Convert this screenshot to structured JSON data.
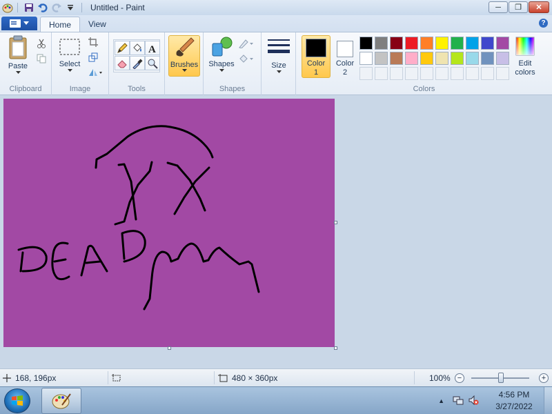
{
  "window": {
    "title": "Untitled - Paint",
    "min_symbol": "─",
    "max_symbol": "❐",
    "close_symbol": "✕"
  },
  "ribbon": {
    "tabs": [
      {
        "label": "Home",
        "active": true
      },
      {
        "label": "View",
        "active": false
      }
    ],
    "help_symbol": "?",
    "groups": {
      "clipboard": {
        "label": "Clipboard",
        "paste": "Paste"
      },
      "image": {
        "label": "Image",
        "select": "Select"
      },
      "tools": {
        "label": "Tools"
      },
      "brushes": {
        "label": "Brushes"
      },
      "shapes": {
        "label": "Shapes",
        "shapes_label": "Shapes"
      },
      "size": {
        "label": "Size"
      },
      "colors": {
        "label": "Colors",
        "color1_label_line1": "Color",
        "color1_label_line2": "1",
        "color2_label_line1": "Color",
        "color2_label_line2": "2",
        "edit_label_line1": "Edit",
        "edit_label_line2": "colors",
        "color1": "#000000",
        "color2": "#ffffff",
        "palette_row1": [
          "#000000",
          "#7f7f7f",
          "#880015",
          "#ed1c24",
          "#ff7f27",
          "#fff200",
          "#22b14c",
          "#00a2e8",
          "#3f48cc",
          "#a349a4"
        ],
        "palette_row2": [
          "#ffffff",
          "#c3c3c3",
          "#b97a57",
          "#ffaec9",
          "#ffc90e",
          "#efe4b0",
          "#b5e61d",
          "#99d9ea",
          "#7092be",
          "#c8bfe7"
        ]
      }
    }
  },
  "canvas": {
    "background": "#a249a4",
    "stroke_color": "#000000"
  },
  "status": {
    "cursor_pos": "168, 196px",
    "image_size": "480 × 360px",
    "zoom": "100%",
    "zoom_level": 1.0,
    "zoom_minus": "−",
    "zoom_plus": "+"
  },
  "taskbar": {
    "time": "4:56 PM",
    "date": "3/27/2022",
    "tray_arrow": "▲"
  }
}
